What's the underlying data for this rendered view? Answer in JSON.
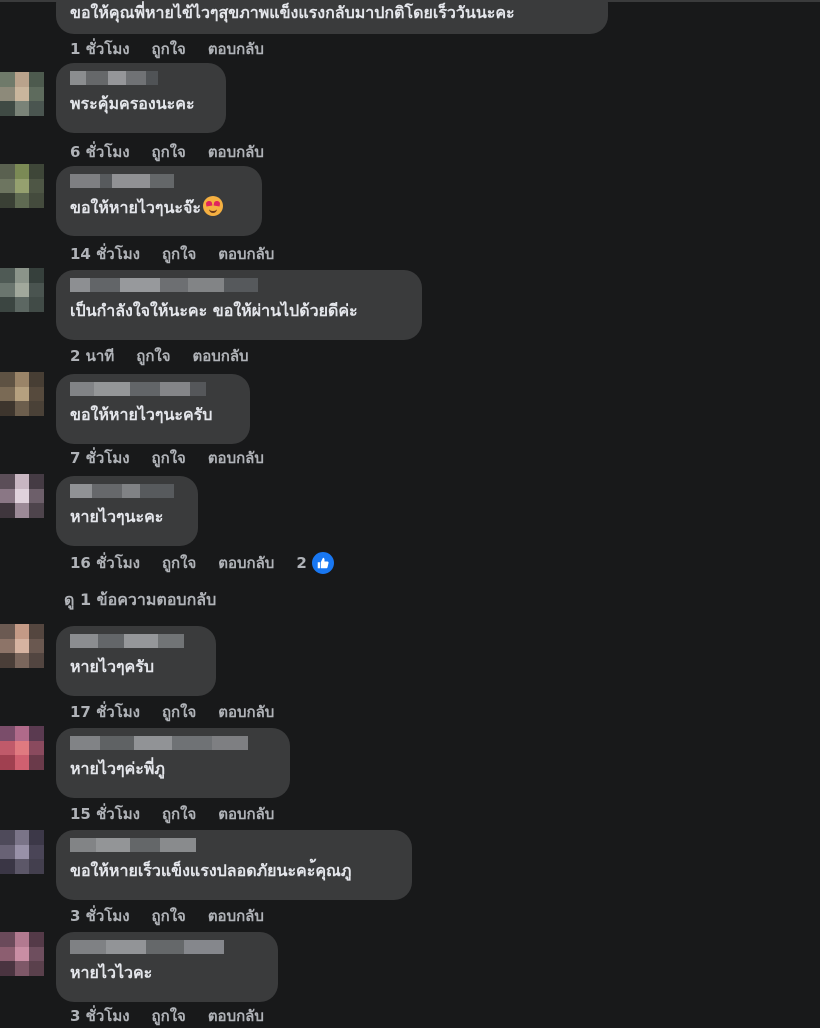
{
  "actions": {
    "like": "ถูกใจ",
    "reply": "ตอบกลับ"
  },
  "comments": [
    {
      "text": "ขอให้คุณพี่หายไข้ไวๆสุขภาพแข็งแรงกลับมาปกติโดยเร็ววันนะคะ",
      "time": "1 ชั่วโมง"
    },
    {
      "text": "พระคุ้มครองนะคะ",
      "time": "6 ชั่วโมง"
    },
    {
      "text": "ขอให้หายไวๆนะจ๊ะ",
      "time": "14 ชั่วโมง"
    },
    {
      "text": "เป็นกำลังใจให้นะคะ ขอให้ผ่านไปด้วยดีค่ะ",
      "time": "2 นาที"
    },
    {
      "text": "ขอให้หายไวๆนะครับ",
      "time": "7 ชั่วโมง"
    },
    {
      "text": "หายไวๆนะคะ",
      "time": "16 ชั่วโมง",
      "reaction_count": "2"
    },
    {
      "text": "หายไวๆครับ",
      "time": "17 ชั่วโมง"
    },
    {
      "text": "หายไวๆค่ะพี่ภู",
      "time": "15 ชั่วโมง"
    },
    {
      "text": "ขอให้หายเร็วแข็งแรงปลอดภัยนะคะ้คุณภู",
      "time": "3 ชั่วโมง"
    },
    {
      "text": "หายไวไวคะ",
      "time": "3 ชั่วโมง"
    }
  ],
  "view_replies": "ดู 1 ข้อความตอบกลับ",
  "colors": {
    "background": "#18191a",
    "bubble": "#3a3b3c",
    "text": "#e4e6eb",
    "meta": "#b0b3b8",
    "like_badge": "#1877f2"
  },
  "icons": {
    "reaction": "thumbs-up-icon",
    "emoji": "smiling-face-with-hearts-icon"
  }
}
